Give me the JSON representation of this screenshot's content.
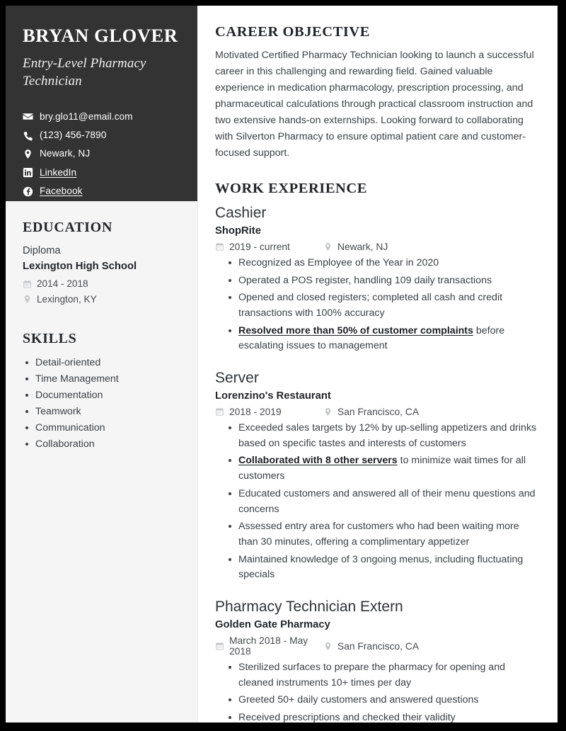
{
  "profile": {
    "name": "BRYAN GLOVER",
    "tagline": "Entry-Level Pharmacy Technician",
    "contacts": [
      {
        "icon": "envelope-icon",
        "text": "bry.glo11@email.com",
        "is_link": false
      },
      {
        "icon": "phone-icon",
        "text": "(123) 456-7890",
        "is_link": false
      },
      {
        "icon": "location-pin-icon",
        "text": "Newark, NJ",
        "is_link": false
      },
      {
        "icon": "linkedin-icon",
        "text": "LinkedIn",
        "is_link": true
      },
      {
        "icon": "facebook-icon",
        "text": "Facebook",
        "is_link": true
      }
    ]
  },
  "education": {
    "heading": "EDUCATION",
    "degree": "Diploma",
    "school": "Lexington High School",
    "dates": "2014 - 2018",
    "location": "Lexington, KY"
  },
  "skills": {
    "heading": "SKILLS",
    "items": [
      "Detail-oriented",
      "Time Management",
      "Documentation",
      "Teamwork",
      "Communication",
      "Collaboration"
    ]
  },
  "objective": {
    "heading": "CAREER OBJECTIVE",
    "text": "Motivated Certified Pharmacy Technician looking to launch a successful career in this challenging and rewarding field. Gained valuable experience in medication pharmacology, prescription processing, and pharmaceutical calculations through practical classroom instruction and two extensive hands-on externships. Looking forward to collaborating with Silverton Pharmacy to ensure optimal patient care and customer-focused support."
  },
  "work": {
    "heading": "WORK EXPERIENCE",
    "jobs": [
      {
        "title": "Cashier",
        "company": "ShopRite",
        "dates": "2019 - current",
        "location": "Newark, NJ",
        "bullets": [
          {
            "highlight": "",
            "rest": "Recognized as Employee of the Year in 2020"
          },
          {
            "highlight": "",
            "rest": "Operated a POS register, handling 109 daily transactions"
          },
          {
            "highlight": "",
            "rest": "Opened and closed registers; completed all cash and credit transactions with 100% accuracy"
          },
          {
            "highlight": "Resolved more than 50% of customer complaints",
            "rest": " before escalating issues to management"
          }
        ]
      },
      {
        "title": "Server",
        "company": "Lorenzino's Restaurant",
        "dates": "2018 - 2019",
        "location": "San Francisco, CA",
        "bullets": [
          {
            "highlight": "",
            "rest": "Exceeded sales targets by 12% by up-selling appetizers and drinks based on specific tastes and interests of customers"
          },
          {
            "highlight": "Collaborated with 8 other servers",
            "rest": " to minimize wait times for all customers"
          },
          {
            "highlight": "",
            "rest": "Educated customers and answered all of their menu questions and concerns"
          },
          {
            "highlight": "",
            "rest": "Assessed entry area for customers who had been waiting more than 30 minutes, offering a complimentary appetizer"
          },
          {
            "highlight": "",
            "rest": "Maintained knowledge of 3 ongoing menus, including fluctuating specials"
          }
        ]
      },
      {
        "title": "Pharmacy Technician Extern",
        "company": "Golden Gate Pharmacy",
        "dates": "March 2018 - May 2018",
        "location": "San Francisco, CA",
        "bullets": [
          {
            "highlight": "",
            "rest": "Sterilized surfaces to prepare the pharmacy for opening and cleaned instruments 10+ times per day"
          },
          {
            "highlight": "",
            "rest": "Greeted 50+ daily customers and answered questions"
          },
          {
            "highlight": "",
            "rest": "Received prescriptions and checked their validity"
          }
        ]
      }
    ]
  },
  "colors": {
    "header_dark": "#333333",
    "sidebar_light": "#f5f5f5",
    "body_text": "#3a3f45",
    "heading_text": "#23262b",
    "page_border": "#000000"
  }
}
